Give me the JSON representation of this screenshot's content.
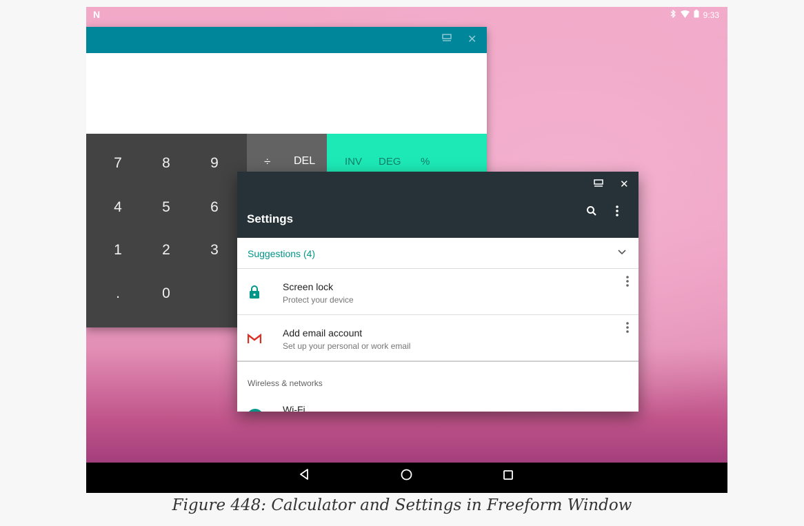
{
  "status_bar": {
    "notification_icon": "N",
    "icons": [
      "bluetooth-icon",
      "wifi-icon",
      "battery-icon"
    ],
    "time": "9:33"
  },
  "calculator": {
    "caption_buttons": [
      "window-mode-icon",
      "close-icon"
    ],
    "display_value": "",
    "digit_keys": [
      "7",
      "8",
      "9",
      "4",
      "5",
      "6",
      "1",
      "2",
      "3",
      ".",
      "0"
    ],
    "operator_keys": [
      "÷",
      "DEL"
    ],
    "advanced_keys": [
      "INV",
      "DEG",
      "%"
    ],
    "colors": {
      "caption": "#00869a",
      "numpad": "#434343",
      "advanced": "#1de9b6"
    }
  },
  "settings": {
    "caption_buttons": [
      "window-mode-icon",
      "close-icon"
    ],
    "title": "Settings",
    "toolbar_icons": [
      "search-icon",
      "more-vert-icon"
    ],
    "suggestions_label": "Suggestions (4)",
    "rows": [
      {
        "title": "Screen lock",
        "subtitle": "Protect your device",
        "icon": "lock-icon"
      },
      {
        "title": "Add email account",
        "subtitle": "Set up your personal or work email",
        "icon": "gmail-icon"
      }
    ],
    "category": "Wireless & networks",
    "wifi_label": "Wi-Fi",
    "colors": {
      "toolbar": "#263238",
      "accent": "#009688"
    }
  },
  "nav_bar": {
    "buttons": [
      "back-icon",
      "home-icon",
      "recents-icon"
    ]
  },
  "figure_caption": "Figure 448: Calculator and Settings in Freeform Window"
}
